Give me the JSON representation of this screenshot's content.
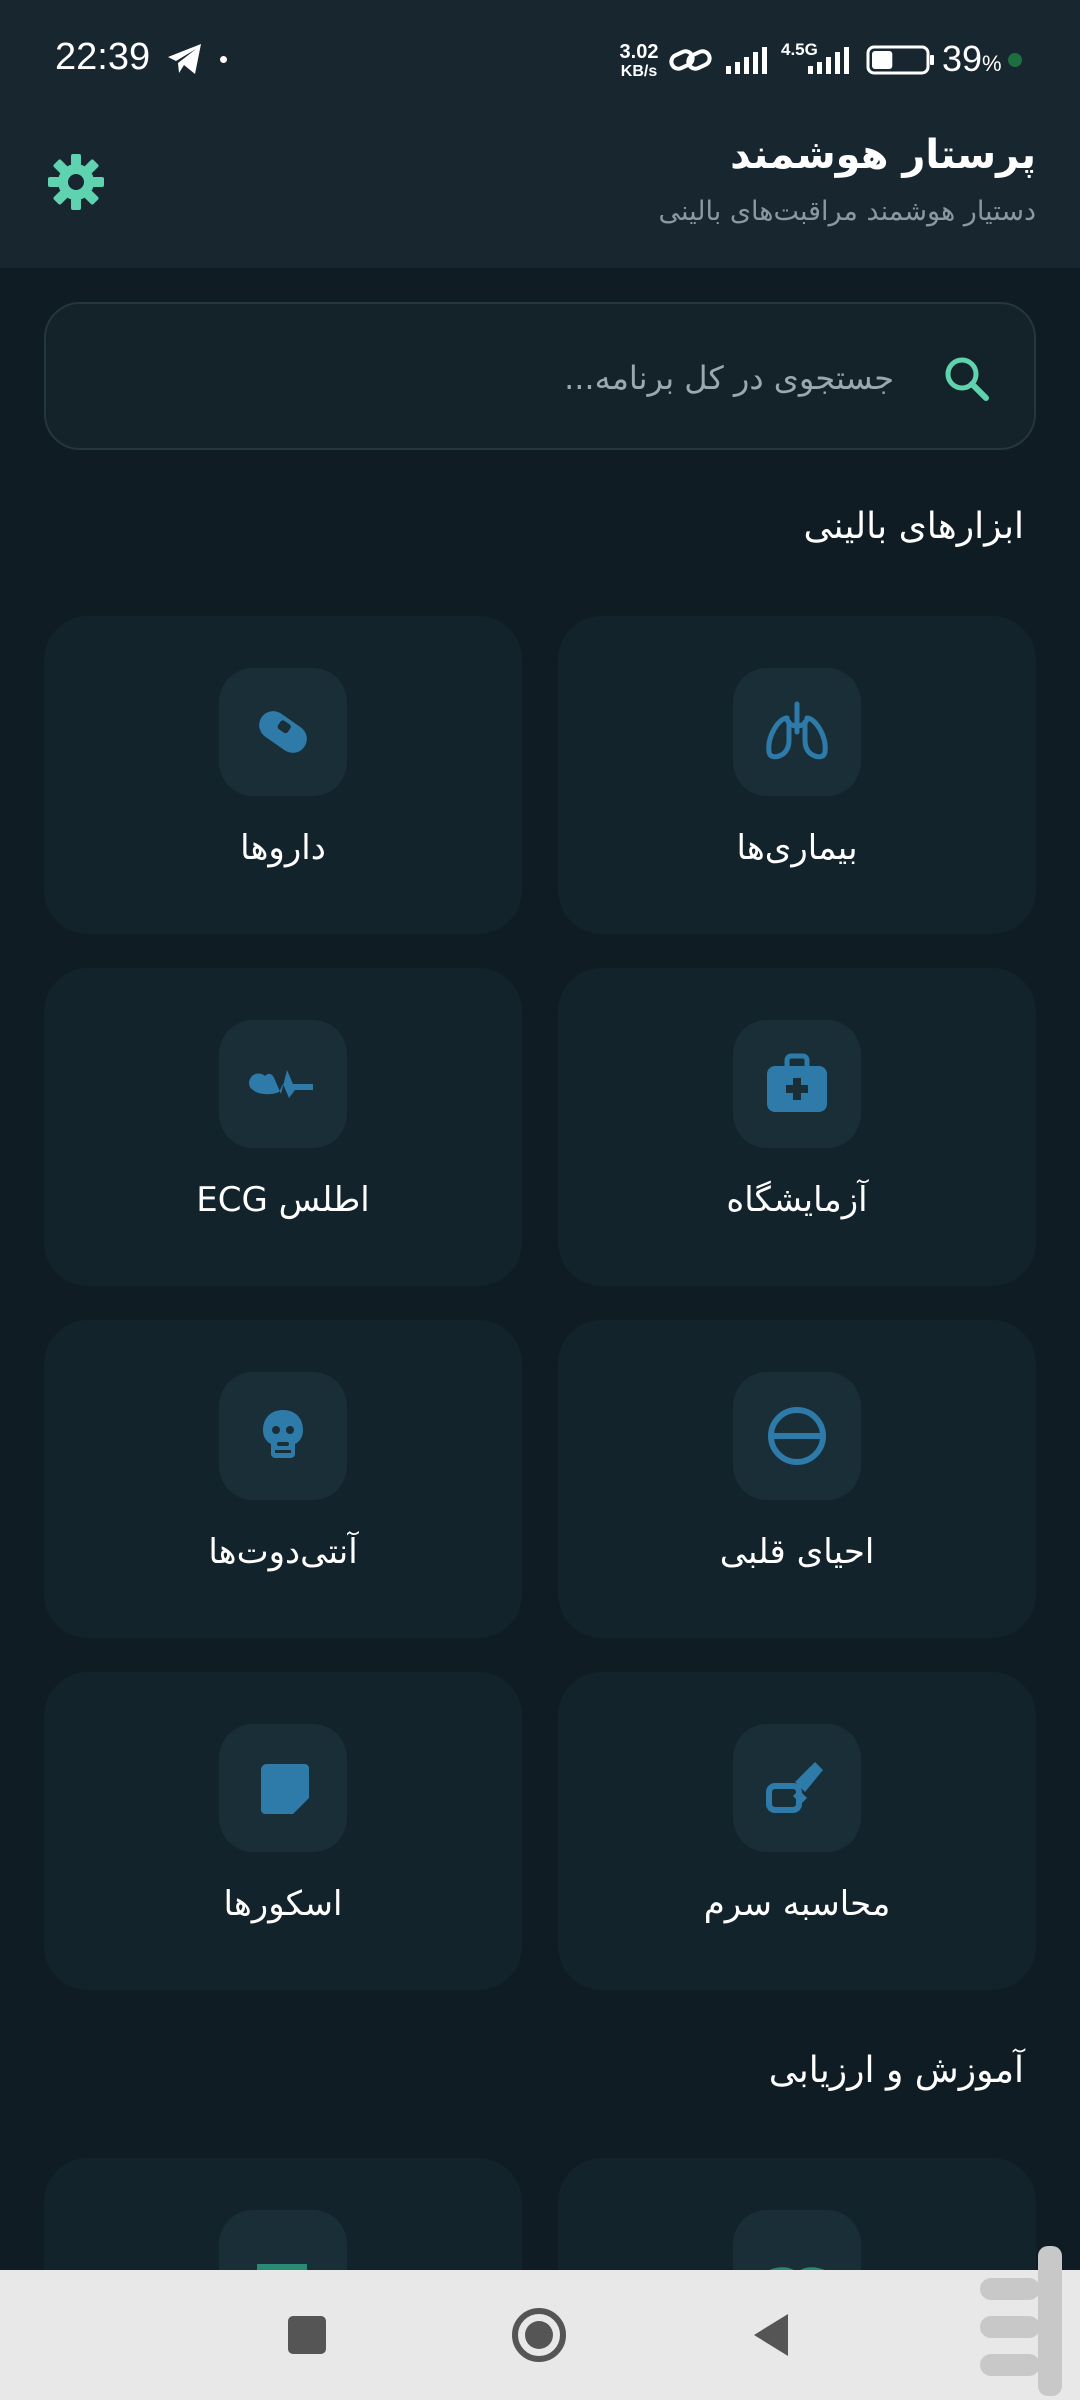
{
  "status_bar": {
    "time": "22:39",
    "speed_value": "3.02",
    "speed_unit": "KB/s",
    "network": "4.5G",
    "battery_percent": "39",
    "percent_sign": "%",
    "battery_level": 0.39,
    "icons": [
      "telegram-icon",
      "link-icon",
      "signal-icon",
      "battery-icon"
    ]
  },
  "header": {
    "title": "پرستار هوشمند",
    "subtitle": "دستیار هوشمند مراقبت‌های بالینی",
    "settings_icon": "gear-icon"
  },
  "search": {
    "placeholder": "جستجوی در کل برنامه...",
    "value": "",
    "icon": "search-icon"
  },
  "sections": {
    "clinical_tools": "ابزارهای بالینی",
    "education": "آموزش و ارزیابی"
  },
  "tools": [
    {
      "label": "بیماری‌ها",
      "icon": "lungs-icon"
    },
    {
      "label": "داروها",
      "icon": "pill-icon"
    },
    {
      "label": "آزمایشگاه",
      "icon": "medical-kit-icon"
    },
    {
      "label": "اطلس ECG",
      "icon": "ecg-icon"
    },
    {
      "label": "احیای قلبی",
      "icon": "cpr-icon"
    },
    {
      "label": "آنتی‌دوت‌ها",
      "icon": "skull-icon"
    },
    {
      "label": "محاسبه سرم",
      "icon": "syringe-icon"
    },
    {
      "label": "اسکورها",
      "icon": "note-icon"
    }
  ],
  "education_items": [
    {
      "icon": "book-icon"
    },
    {
      "icon": "quiz-icon"
    }
  ],
  "colors": {
    "background": "#0f1c23",
    "header": "#182630",
    "card": "#13232b",
    "icon_box": "#1a2e38",
    "icon_blue": "#2e7aa8",
    "accent_green": "#5fd3b0",
    "navbar": "#e8e8e8"
  },
  "navbar": {
    "buttons": [
      "recent-apps-button",
      "home-button",
      "back-button"
    ]
  }
}
